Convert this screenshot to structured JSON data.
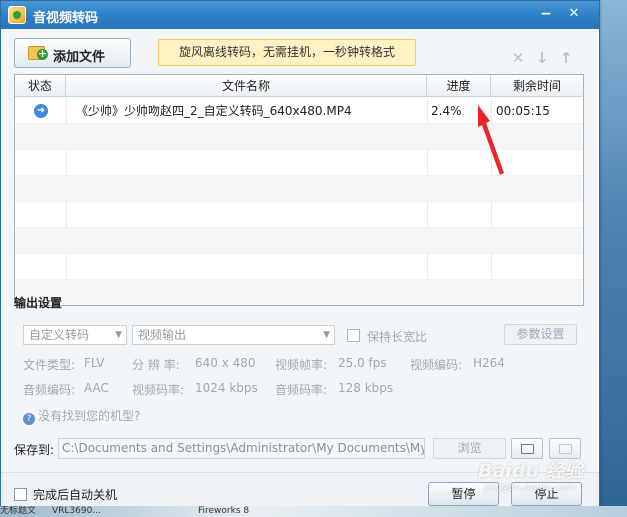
{
  "window": {
    "title": "音视频转码",
    "minimize": "−",
    "close": "✕"
  },
  "toolbar": {
    "add_file_label": "添加文件",
    "promo_text": "旋风离线转码，无需挂机，一秒钟转格式",
    "icons": [
      "delete-icon",
      "move-down-icon",
      "move-up-icon"
    ]
  },
  "table": {
    "headers": {
      "status": "状态",
      "filename": "文件名称",
      "progress": "进度",
      "remaining": "剩余时间"
    },
    "rows": [
      {
        "status_icon": "arrow-right-circle-icon",
        "filename": "《少帅》少帅吻赵四_2_自定义转码_640x480.MP4",
        "progress": "2.4%",
        "remaining": "00:05:15"
      }
    ]
  },
  "output": {
    "section_title": "输出设置",
    "preset_value": "自定义转码",
    "output_type_value": "视频输出",
    "keep_ratio_label": "保持长宽比",
    "params_button": "参数设置",
    "file_type_label": "文件类型:",
    "file_type_value": "FLV",
    "resolution_label": "分 辨 率:",
    "resolution_value": "640 x 480",
    "framerate_label": "视频帧率:",
    "framerate_value": "25.0 fps",
    "video_codec_label": "视频编码:",
    "video_codec_value": "H264",
    "audio_codec_label": "音频编码:",
    "audio_codec_value": "AAC",
    "video_bitrate_label": "视频码率:",
    "video_bitrate_value": "1024 kbps",
    "audio_bitrate_label": "音频码率:",
    "audio_bitrate_value": "128 kbps",
    "help_link": "没有找到您的机型?"
  },
  "save": {
    "label": "保存到:",
    "path": "C:\\Documents and Settings\\Administrator\\My Documents\\My Vide",
    "browse_button": "浏览"
  },
  "bottom": {
    "shutdown_label": "完成后自动关机",
    "pause_button": "暂停",
    "stop_button": "停止"
  },
  "taskbar": {
    "items": [
      "无标题文",
      "VRL3690...",
      "Fireworks 8"
    ]
  },
  "watermark": {
    "main": "Baidu 经验",
    "sub": "jingyan.baidu.com"
  },
  "colors": {
    "titlebar": "#2f7fc6",
    "annotation_arrow": "#e8262a",
    "promo_bg": "#fff2c2"
  }
}
